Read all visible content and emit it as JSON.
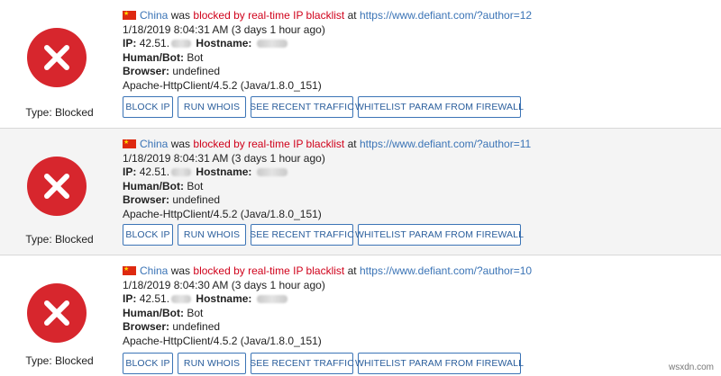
{
  "entries": [
    {
      "country": "China",
      "reason": "blocked by real-time IP blacklist",
      "was": "was",
      "at": "at",
      "url": "https://www.defiant.com/?author=12",
      "timestamp": "1/18/2019 8:04:31 AM (3 days 1 hour ago)",
      "ip_label": "IP:",
      "ip_value": "42.51.",
      "hostname_label": "Hostname:",
      "human_bot_label": "Human/Bot:",
      "human_bot_value": "Bot",
      "browser_label": "Browser:",
      "browser_value": "undefined",
      "user_agent": "Apache-HttpClient/4.5.2 (Java/1.8.0_151)",
      "type_label": "Type: Blocked"
    },
    {
      "country": "China",
      "reason": "blocked by real-time IP blacklist",
      "was": "was",
      "at": "at",
      "url": "https://www.defiant.com/?author=11",
      "timestamp": "1/18/2019 8:04:31 AM (3 days 1 hour ago)",
      "ip_label": "IP:",
      "ip_value": "42.51.",
      "hostname_label": "Hostname:",
      "human_bot_label": "Human/Bot:",
      "human_bot_value": "Bot",
      "browser_label": "Browser:",
      "browser_value": "undefined",
      "user_agent": "Apache-HttpClient/4.5.2 (Java/1.8.0_151)",
      "type_label": "Type: Blocked"
    },
    {
      "country": "China",
      "reason": "blocked by real-time IP blacklist",
      "was": "was",
      "at": "at",
      "url": "https://www.defiant.com/?author=10",
      "timestamp": "1/18/2019 8:04:30 AM (3 days 1 hour ago)",
      "ip_label": "IP:",
      "ip_value": "42.51.",
      "hostname_label": "Hostname:",
      "human_bot_label": "Human/Bot:",
      "human_bot_value": "Bot",
      "browser_label": "Browser:",
      "browser_value": "undefined",
      "user_agent": "Apache-HttpClient/4.5.2 (Java/1.8.0_151)",
      "type_label": "Type: Blocked"
    }
  ],
  "buttons": {
    "block_ip": "BLOCK IP",
    "run_whois": "RUN WHOIS",
    "recent_traffic": "SEE RECENT TRAFFIC",
    "whitelist_param": "WHITELIST PARAM FROM FIREWALL"
  },
  "icons": {
    "status": "blocked-x-icon",
    "flag": "china-flag-icon"
  },
  "colors": {
    "blocked_red": "#d7262d",
    "link_blue": "#3b74b6",
    "reason_red": "#d0021b",
    "alt_row_bg": "#f4f4f4"
  },
  "watermark": "wsxdn.com"
}
